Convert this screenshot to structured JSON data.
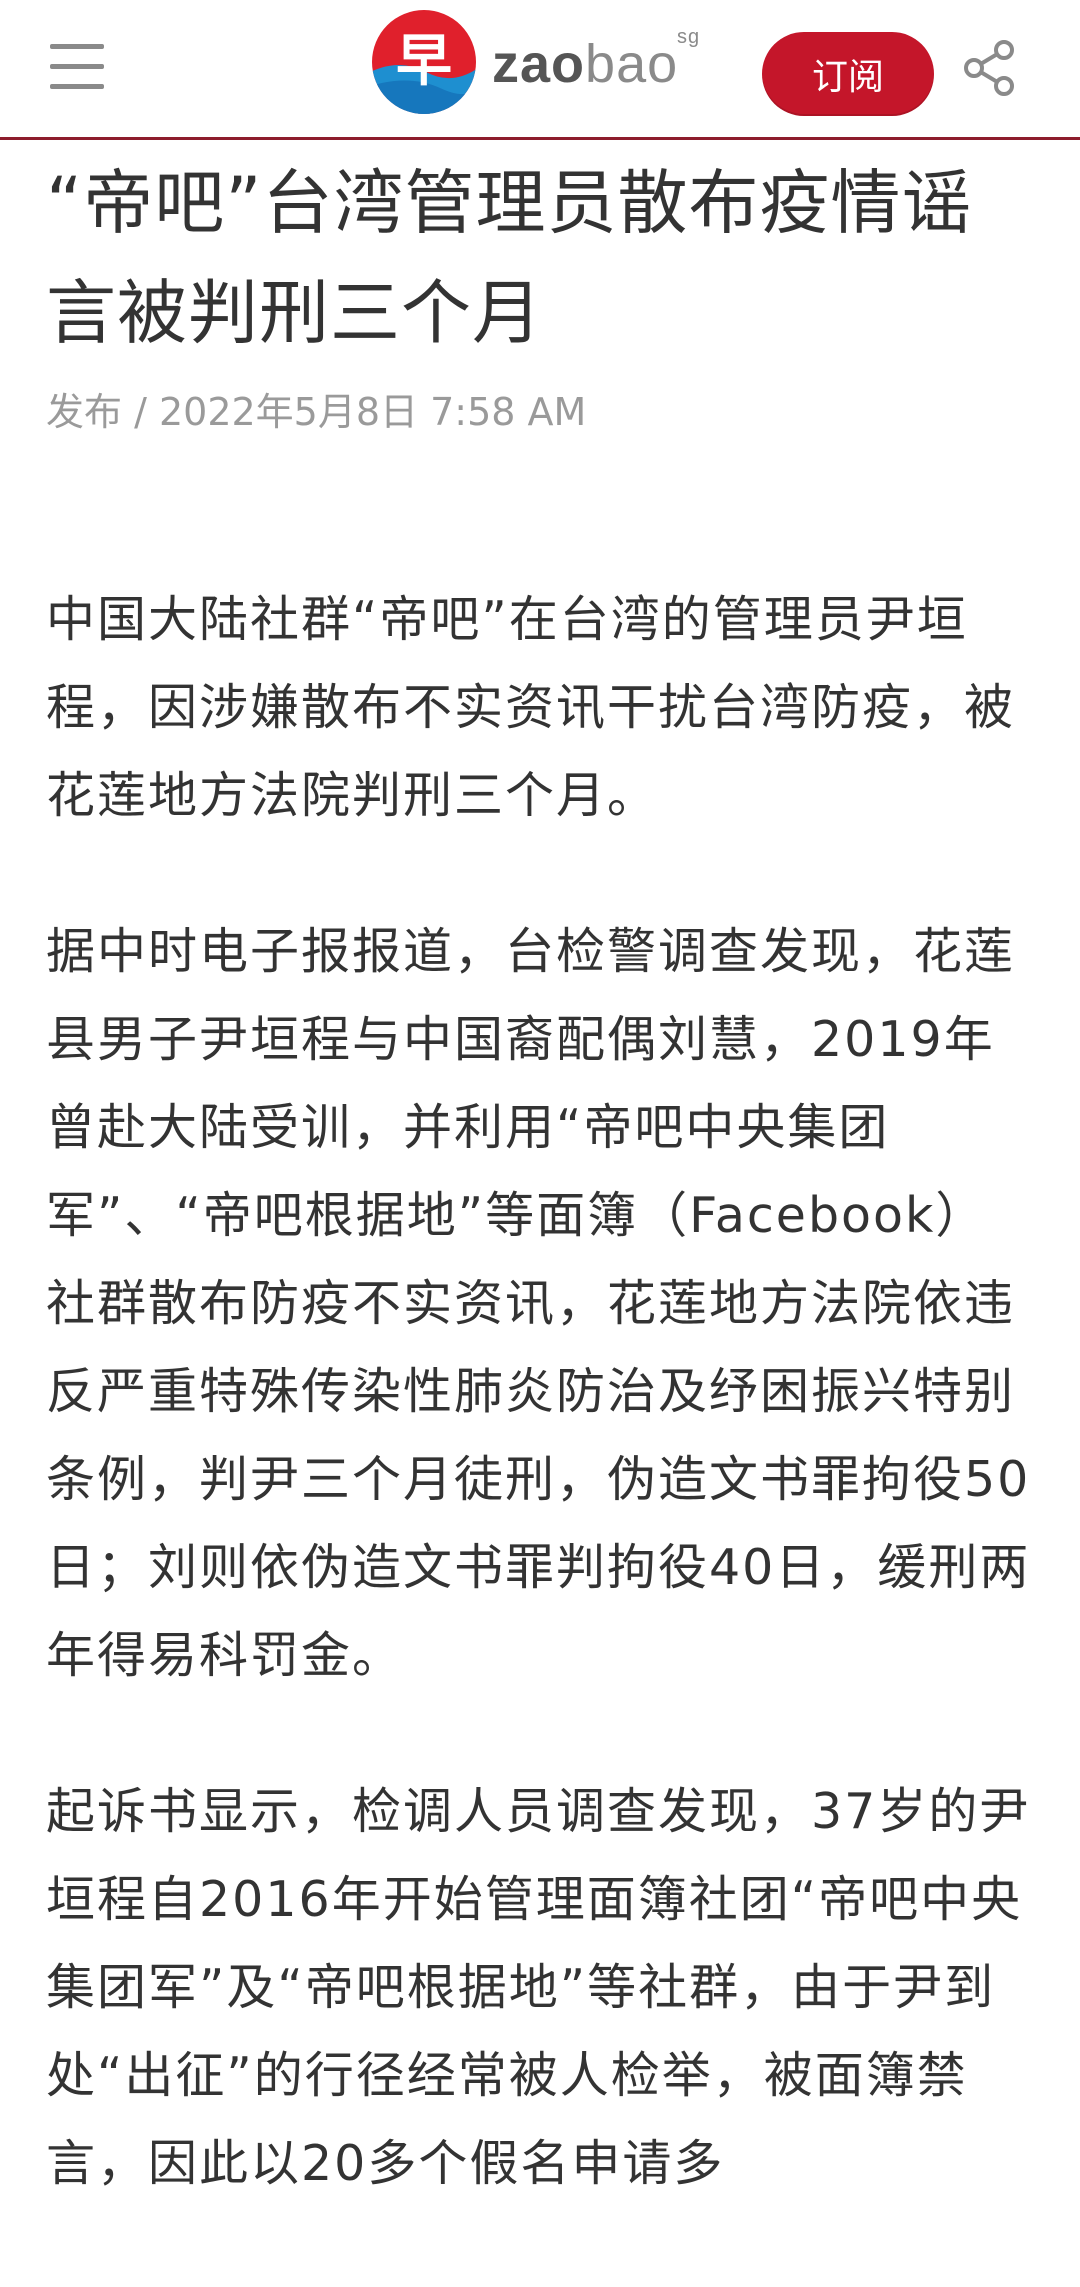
{
  "header": {
    "menu_icon": "hamburger-menu-icon",
    "logo": {
      "mark_char": "早",
      "word_zao": "zao",
      "word_bao": "bao",
      "word_sg": "sg"
    },
    "subscribe_label": "订阅",
    "share_icon": "share-icon",
    "accent_color": "#c4162a",
    "rule_color": "#8d1d2c"
  },
  "article": {
    "title": "“帝吧”台湾管理员散布疫情谣言被判刑三个月",
    "meta": "发布 / 2022年5月8日 7:58 AM",
    "paragraphs": [
      "中国大陆社群“帝吧”在台湾的管理员尹垣程，因涉嫌散布不实资讯干扰台湾防疫，被花莲地方法院判刑三个月。",
      "据中时电子报报道，台检警调查发现，花莲县男子尹垣程与中国裔配偶刘慧，2019年曾赴大陆受训，并利用“帝吧中央集团军”、“帝吧根据地”等面簿（Facebook）社群散布防疫不实资讯，花莲地方法院依违反严重特殊传染性肺炎防治及纾困振兴特别条例，判尹三个月徒刑，伪造文书罪拘役50日；刘则依伪造文书罪判拘役40日，缓刑两年得易科罚金。",
      "起诉书显示，检调人员调查发现，37岁的尹垣程自2016年开始管理面簿社团“帝吧中央集团军”及“帝吧根据地”等社群，由于尹到处“出征”的行径经常被人检举，被面簿禁言，因此以20多个假名申请多"
    ]
  }
}
